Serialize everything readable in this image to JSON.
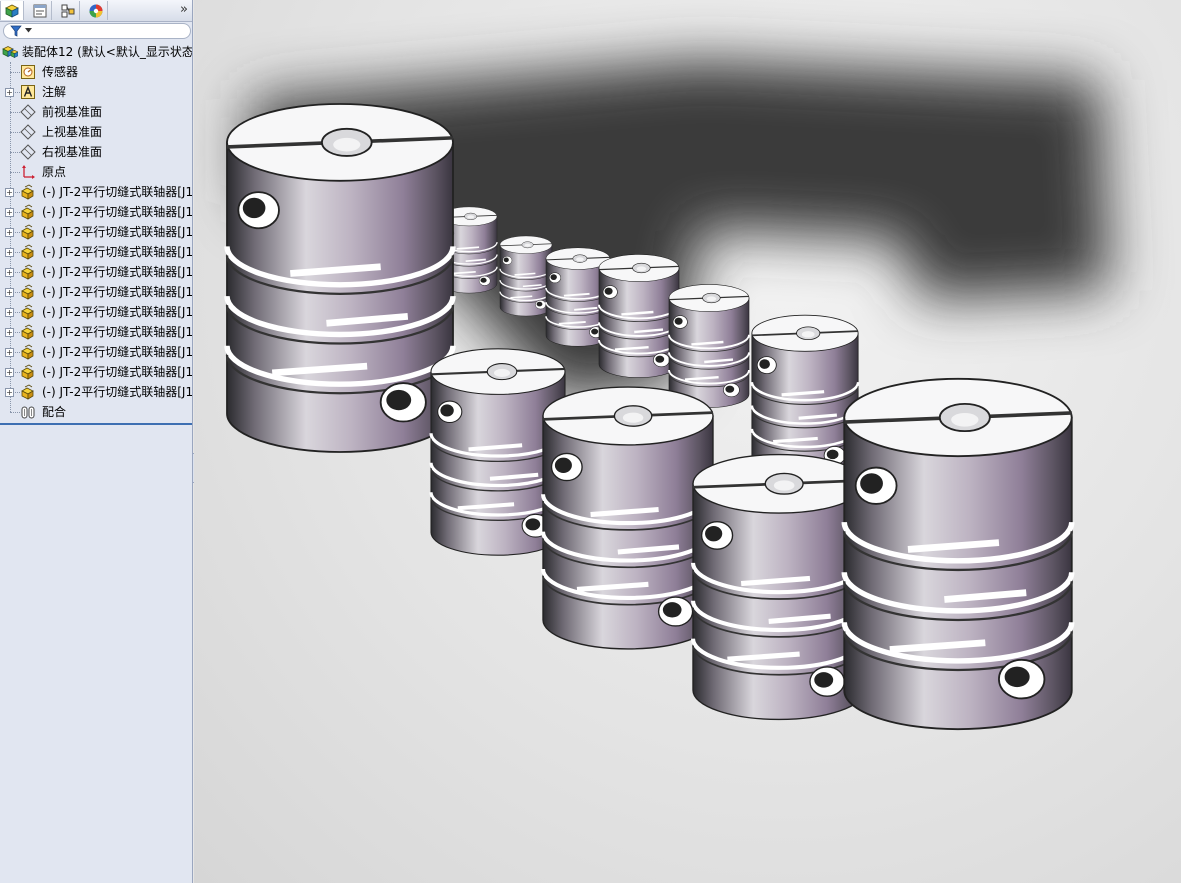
{
  "panel": {
    "tabs": [
      {
        "icon": "feature-manager-icon"
      },
      {
        "icon": "property-manager-icon"
      },
      {
        "icon": "configuration-manager-icon"
      },
      {
        "icon": "display-manager-icon"
      }
    ],
    "more_label": "»",
    "filter": {
      "icon": "filter-icon"
    }
  },
  "tree": {
    "root": {
      "label": "装配体12  (默认<默认_显示状态",
      "icon": "assembly-icon"
    },
    "items": [
      {
        "label": "传感器",
        "icon": "sensor-icon",
        "expandable": false
      },
      {
        "label": "注解",
        "icon": "annotation-icon",
        "expandable": true
      },
      {
        "label": "前视基准面",
        "icon": "plane-icon",
        "expandable": false
      },
      {
        "label": "上视基准面",
        "icon": "plane-icon",
        "expandable": false
      },
      {
        "label": "右视基准面",
        "icon": "plane-icon",
        "expandable": false
      },
      {
        "label": "原点",
        "icon": "origin-icon",
        "expandable": false
      },
      {
        "label": "(-) JT-2平行切缝式联轴器[J1",
        "icon": "part-icon",
        "expandable": true
      },
      {
        "label": "(-) JT-2平行切缝式联轴器[J1",
        "icon": "part-icon",
        "expandable": true
      },
      {
        "label": "(-) JT-2平行切缝式联轴器[J1",
        "icon": "part-icon",
        "expandable": true
      },
      {
        "label": "(-) JT-2平行切缝式联轴器[J1",
        "icon": "part-icon",
        "expandable": true
      },
      {
        "label": "(-) JT-2平行切缝式联轴器[J1",
        "icon": "part-icon",
        "expandable": true
      },
      {
        "label": "(-) JT-2平行切缝式联轴器[J1",
        "icon": "part-icon",
        "expandable": true
      },
      {
        "label": "(-) JT-2平行切缝式联轴器[J1",
        "icon": "part-icon",
        "expandable": true
      },
      {
        "label": "(-) JT-2平行切缝式联轴器[J1",
        "icon": "part-icon",
        "expandable": true
      },
      {
        "label": "(-) JT-2平行切缝式联轴器[J1",
        "icon": "part-icon",
        "expandable": true
      },
      {
        "label": "(-) JT-2平行切缝式联轴器[J1",
        "icon": "part-icon",
        "expandable": true
      },
      {
        "label": "(-) JT-2平行切缝式联轴器[J1",
        "icon": "part-icon",
        "expandable": true
      },
      {
        "label": "配合",
        "icon": "mates-icon",
        "expandable": false
      }
    ]
  },
  "viewport": {
    "content": "assembly-of-11-slit-couplings",
    "colors": {
      "background": "#e6e6e6",
      "coupling_body": "#a9a3af",
      "coupling_face": "#ffffff",
      "shadow": "#3a3a3a"
    }
  }
}
